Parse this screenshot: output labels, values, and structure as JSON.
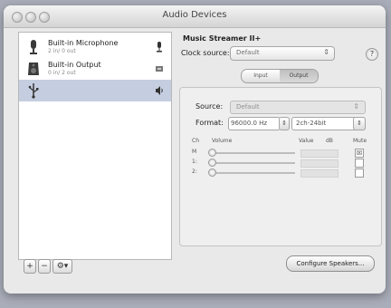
{
  "window": {
    "title": "Audio Devices"
  },
  "devices": [
    {
      "name": "Built-in Microphone",
      "sub": "2 in/ 0 out",
      "icon": "microphone-icon",
      "right_icon": "microphone-small-icon"
    },
    {
      "name": "Built-in Output",
      "sub": "0 in/ 2 out",
      "icon": "speaker-icon",
      "right_icon": "output-badge-icon"
    },
    {
      "name": "",
      "sub": "",
      "icon": "usb-icon",
      "right_icon": "speaker-volume-icon",
      "selected": true
    }
  ],
  "sidebar_controls": {
    "add": "+",
    "remove": "−",
    "action": "⚙▾"
  },
  "right": {
    "title": "Music Streamer II+",
    "clock_label": "Clock source:",
    "clock_value": "Default",
    "help": "?",
    "tabs": [
      "Input",
      "Output"
    ],
    "active_tab": "Output"
  },
  "panel": {
    "source_label": "Source:",
    "source_value": "Default",
    "format_label": "Format:",
    "format_rate": "96000.0 Hz",
    "format_channels": "2ch-24bit",
    "headers": {
      "ch": "Ch",
      "volume": "Volume",
      "value": "Value",
      "db": "dB",
      "mute": "Mute"
    },
    "channels": [
      {
        "label": "M",
        "mute": "☒"
      },
      {
        "label": "1:",
        "mute": ""
      },
      {
        "label": "2:",
        "mute": ""
      }
    ]
  },
  "configure_button": "Configure Speakers..."
}
